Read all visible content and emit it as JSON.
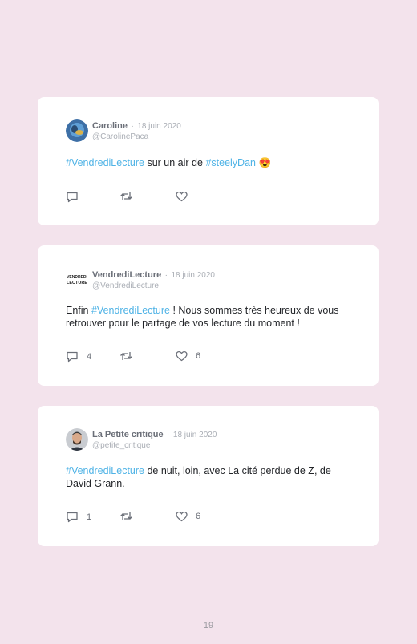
{
  "tweets": [
    {
      "name": "Caroline",
      "separator": "·",
      "date": "18 juin 2020",
      "handle": "@CarolinePaca",
      "text_parts": [
        {
          "text": "#VendrediLecture",
          "tag": true
        },
        {
          "text": " sur un air de ",
          "tag": false
        },
        {
          "text": "#steelyDan",
          "tag": true
        },
        {
          "text": " 😍",
          "tag": false
        }
      ],
      "reply_count": "",
      "retweet_count": "",
      "like_count": ""
    },
    {
      "name": "VendrediLecture",
      "separator": "·",
      "date": "18 juin 2020",
      "handle": "@VendrediLecture",
      "avatar_logo": "VENDREDI LECTURE",
      "text_parts": [
        {
          "text": "Enfin ",
          "tag": false
        },
        {
          "text": "#VendrediLecture",
          "tag": true
        },
        {
          "text": " ! Nous sommes très heureux de vous retrouver pour le partage de vos lecture du moment !",
          "tag": false
        }
      ],
      "reply_count": "4",
      "retweet_count": "",
      "like_count": "6"
    },
    {
      "name": "La Petite critique",
      "separator": "·",
      "date": "18 juin 2020",
      "handle": "@petite_critique",
      "text_parts": [
        {
          "text": "#VendrediLecture",
          "tag": true
        },
        {
          "text": " de nuit, loin, avec La cité perdue de Z, de David Grann.",
          "tag": false
        }
      ],
      "reply_count": "1",
      "retweet_count": "",
      "like_count": "6"
    }
  ],
  "page_number": "19",
  "colors": {
    "background": "#f3e3ec",
    "hashtag": "#4fb3e6",
    "icon": "#6b6f78"
  },
  "icons": [
    "reply-icon",
    "retweet-icon",
    "like-icon"
  ]
}
